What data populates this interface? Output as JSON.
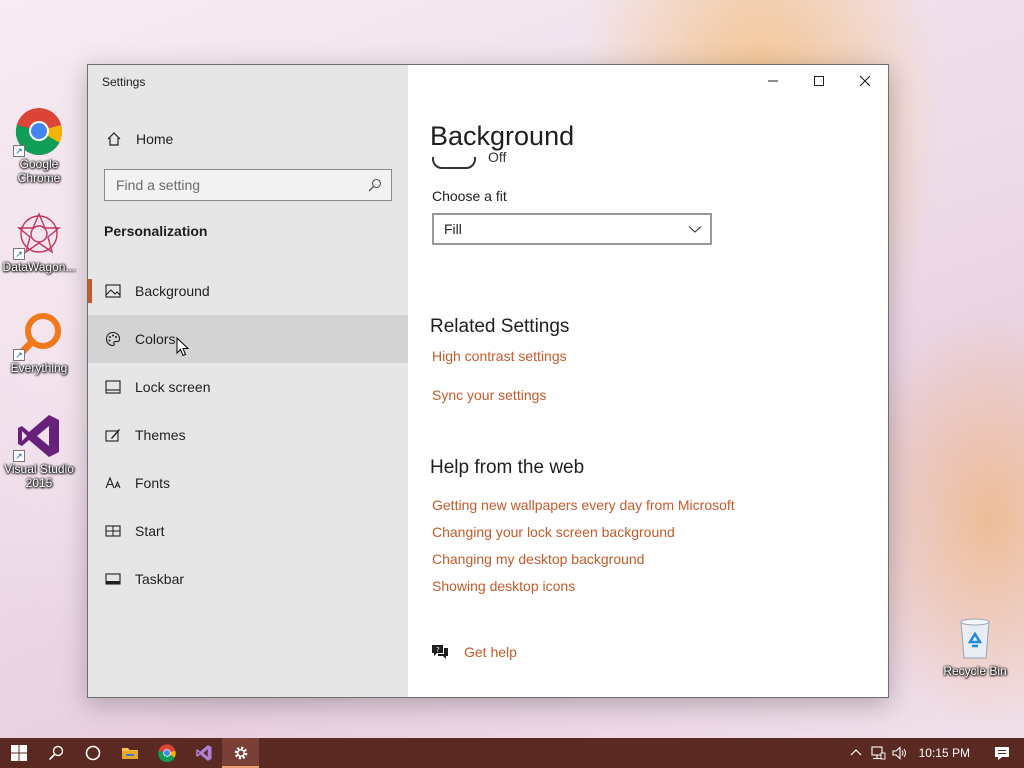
{
  "desktop": {
    "icons": [
      {
        "label": "Google Chrome",
        "icon": "chrome-icon"
      },
      {
        "label": "DataWagon...",
        "icon": "datawagon-icon"
      },
      {
        "label": "Everything",
        "icon": "everything-search-icon"
      },
      {
        "label": "Visual Studio 2015",
        "icon": "visual-studio-icon"
      },
      {
        "label": "Recycle Bin",
        "icon": "recycle-bin-icon"
      }
    ]
  },
  "window": {
    "title": "Settings",
    "controls": {
      "minimize": "minimize-icon",
      "maximize": "maximize-icon",
      "close": "close-icon"
    }
  },
  "sidebar": {
    "home_label": "Home",
    "search_placeholder": "Find a setting",
    "section_title": "Personalization",
    "items": [
      {
        "label": "Background",
        "icon": "picture-icon",
        "selected": true
      },
      {
        "label": "Colors",
        "icon": "palette-icon",
        "hovered": true
      },
      {
        "label": "Lock screen",
        "icon": "lock-screen-icon"
      },
      {
        "label": "Themes",
        "icon": "themes-icon"
      },
      {
        "label": "Fonts",
        "icon": "fonts-icon"
      },
      {
        "label": "Start",
        "icon": "start-icon"
      },
      {
        "label": "Taskbar",
        "icon": "taskbar-icon"
      }
    ]
  },
  "main": {
    "page_title": "Background",
    "toggle_state": "Off",
    "choose_fit_label": "Choose a fit",
    "fit_value": "Fill",
    "related_heading": "Related Settings",
    "related_links": [
      "High contrast settings",
      "Sync your settings"
    ],
    "help_heading": "Help from the web",
    "help_links": [
      "Getting new wallpapers every day from Microsoft",
      "Changing your lock screen background",
      "Changing my desktop background",
      "Showing desktop icons"
    ],
    "get_help": "Get help"
  },
  "taskbar": {
    "clock": "10:15 PM",
    "accent": "#5a2a22"
  },
  "colors": {
    "accent": "#c9592a",
    "link": "#c55b2a"
  }
}
